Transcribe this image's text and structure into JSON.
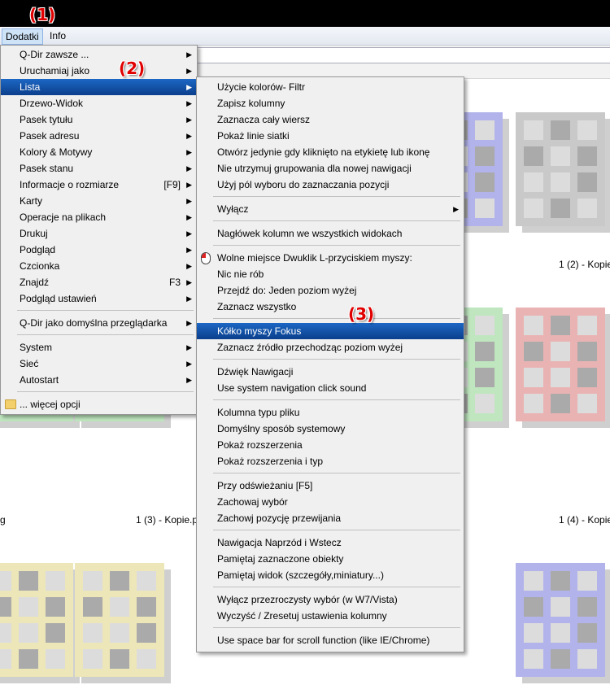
{
  "menubar": {
    "items": [
      "Dodatki",
      "Info"
    ]
  },
  "steps": [
    "(1)",
    "(2)",
    "(3)"
  ],
  "main_menu": {
    "items": [
      {
        "label": "Q-Dir zawsze ...",
        "shortcut": "",
        "arrow": true
      },
      {
        "label": "Uruchamiaj jako",
        "shortcut": "",
        "arrow": true
      },
      {
        "label": "Lista",
        "shortcut": "",
        "arrow": true,
        "selected": true
      },
      {
        "label": "Drzewo-Widok",
        "shortcut": "",
        "arrow": true
      },
      {
        "label": "Pasek tytułu",
        "shortcut": "",
        "arrow": true
      },
      {
        "label": "Pasek adresu",
        "shortcut": "",
        "arrow": true
      },
      {
        "label": "Kolory & Motywy",
        "shortcut": "",
        "arrow": true
      },
      {
        "label": "Pasek stanu",
        "shortcut": "",
        "arrow": true
      },
      {
        "label": "Informacje o rozmiarze",
        "shortcut": "[F9]",
        "arrow": true
      },
      {
        "label": "Karty",
        "shortcut": "",
        "arrow": true
      },
      {
        "label": "Operacje na plikach",
        "shortcut": "",
        "arrow": true
      },
      {
        "label": "Drukuj",
        "shortcut": "",
        "arrow": true
      },
      {
        "label": "Podgląd",
        "shortcut": "",
        "arrow": true
      },
      {
        "label": "Czcionka",
        "shortcut": "",
        "arrow": true
      },
      {
        "label": "Znajdź",
        "shortcut": "F3",
        "arrow": true
      },
      {
        "label": "Podgląd ustawień",
        "shortcut": "",
        "arrow": true
      },
      {
        "sep": true
      },
      {
        "label": "Q-Dir jako domyślna przeglądarka",
        "shortcut": "",
        "arrow": true
      },
      {
        "sep": true
      },
      {
        "label": "System",
        "shortcut": "",
        "arrow": true
      },
      {
        "label": "Sieć",
        "shortcut": "",
        "arrow": true
      },
      {
        "label": "Autostart",
        "shortcut": "",
        "arrow": true
      },
      {
        "sep": true
      },
      {
        "label": "... więcej opcji",
        "shortcut": "",
        "arrow": false,
        "icon": "folder-icon"
      }
    ]
  },
  "sub_menu": {
    "items": [
      {
        "label": "Użycie kolorów- Filtr"
      },
      {
        "label": "Zapisz kolumny"
      },
      {
        "label": "Zaznacza cały wiersz"
      },
      {
        "label": "Pokaż linie siatki"
      },
      {
        "label": "Otwórz jedynie gdy kliknięto na etykietę lub ikonę"
      },
      {
        "label": "Nie utrzymuj grupowania dla nowej nawigacji"
      },
      {
        "label": "Użyj pól wyboru do zaznaczania pozycji"
      },
      {
        "sep": true
      },
      {
        "label": "Wyłącz",
        "arrow": true
      },
      {
        "sep": true
      },
      {
        "label": "Nagłówek kolumn we wszystkich widokach"
      },
      {
        "sep": true
      },
      {
        "label": "Wolne miejsce Dwuklik L-przyciskiem myszy:",
        "icon": "mouse-icon"
      },
      {
        "label": "Nic nie rób"
      },
      {
        "label": "Przejdź do: Jeden poziom wyżej"
      },
      {
        "label": "Zaznacz wszystko"
      },
      {
        "sep": true
      },
      {
        "label": "Kółko myszy Fokus",
        "selected": true
      },
      {
        "label": "Zaznacz źródło przechodząc poziom wyżej"
      },
      {
        "sep": true
      },
      {
        "label": "Dźwięk Nawigacji"
      },
      {
        "label": "Use system navigation click sound"
      },
      {
        "sep": true
      },
      {
        "label": "Kolumna typu pliku"
      },
      {
        "label": "Domyślny sposób systemowy"
      },
      {
        "label": "Pokaż rozszerzenia"
      },
      {
        "label": "Pokaż rozszerzenia i typ"
      },
      {
        "sep": true
      },
      {
        "label": "Przy odświeżaniu [F5]"
      },
      {
        "label": "Zachowaj wybór"
      },
      {
        "label": "Zachowj pozycję przewijania"
      },
      {
        "sep": true
      },
      {
        "label": "Nawigacja Naprzód i Wstecz"
      },
      {
        "label": "Pamiętaj zaznaczone obiekty"
      },
      {
        "label": "Pamiętaj widok (szczegóły,miniatury...)"
      },
      {
        "sep": true
      },
      {
        "label": "Wyłącz przezroczysty wybór (w W7/Vista)"
      },
      {
        "label": "Wyczyść / Zresetuj ustawienia kolumny"
      },
      {
        "sep": true
      },
      {
        "label": "Use space bar for scroll function (like IE/Chrome)"
      }
    ]
  },
  "thumbnails": [
    {
      "caption": "",
      "color": "#b3b3ec"
    },
    {
      "caption": "1 (2) - Kopie",
      "color": "#c9c9c9"
    },
    {
      "caption": "g",
      "color": "#bfe6bf"
    },
    {
      "caption": "1 (3) - Kopie.p",
      "color": "#bfe6bf"
    },
    {
      "caption": "",
      "color": "#bfe6bf"
    },
    {
      "caption": "1 (4) - Kopie",
      "color": "#eab3b3"
    },
    {
      "caption": "",
      "color": "#ece6b8"
    },
    {
      "caption": "",
      "color": "#ece6b8"
    },
    {
      "caption": "",
      "color": "#b3b3ec"
    }
  ],
  "colors": {
    "selection": "#1c67c4",
    "step_label": "#e00000"
  }
}
